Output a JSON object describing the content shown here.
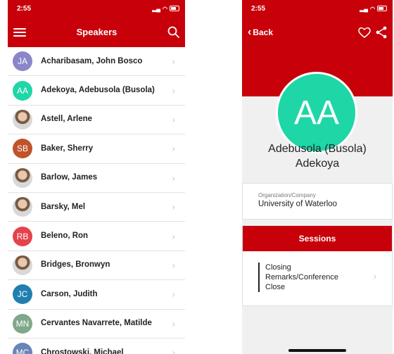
{
  "left": {
    "status_time": "2:55",
    "title": "Speakers",
    "speakers": [
      {
        "name": "Acharibasam, John Bosco",
        "initials": "JA",
        "color": "#8b86c9",
        "photo": false
      },
      {
        "name": "Adekoya, Adebusola (Busola)",
        "initials": "AA",
        "color": "#1fd6a6",
        "photo": false
      },
      {
        "name": "Astell, Arlene",
        "initials": "",
        "color": "#b07a5a",
        "photo": true
      },
      {
        "name": "Baker, Sherry",
        "initials": "SB",
        "color": "#c0532a",
        "photo": false
      },
      {
        "name": "Barlow, James",
        "initials": "",
        "color": "#9a7a66",
        "photo": true
      },
      {
        "name": "Barsky, Mel",
        "initials": "",
        "color": "#3c3030",
        "photo": true
      },
      {
        "name": "Beleno, Ron",
        "initials": "RB",
        "color": "#e5424d",
        "photo": false
      },
      {
        "name": "Bridges, Bronwyn",
        "initials": "",
        "color": "#c9b8a8",
        "photo": true
      },
      {
        "name": "Carson, Judith",
        "initials": "JC",
        "color": "#1f7fb0",
        "photo": false
      },
      {
        "name": "Cervantes Navarrete, Matilde",
        "initials": "MN",
        "color": "#7fa88a",
        "photo": false
      },
      {
        "name": "Chrostowski, Michael",
        "initials": "MC",
        "color": "#6a84b8",
        "photo": false
      }
    ]
  },
  "right": {
    "status_time": "2:55",
    "back_label": "Back",
    "avatar_initials": "AA",
    "full_name_line1": "Adebusola (Busola)",
    "full_name_line2": "Adekoya",
    "org_label": "Organization/Company",
    "org_value": "University of Waterloo",
    "sessions_header": "Sessions",
    "sessions": [
      "Closing Remarks/Conference Close"
    ]
  },
  "colors": {
    "brand_red": "#c8000a",
    "avatar_teal": "#1fd6a6"
  }
}
